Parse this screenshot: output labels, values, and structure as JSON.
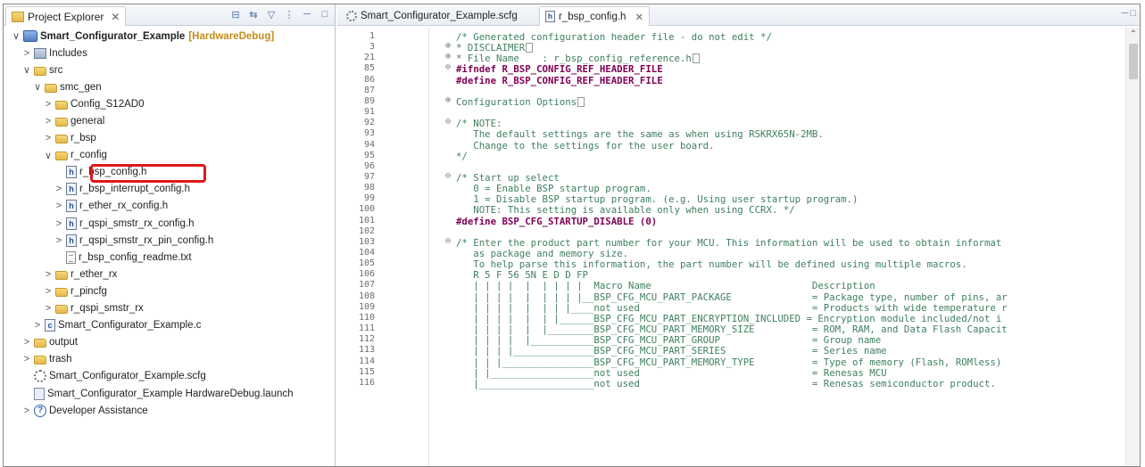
{
  "explorer": {
    "tab_label": "Project Explorer",
    "tab_close": "✕",
    "tree": [
      {
        "indent": 0,
        "chev": "∨",
        "icon": "proj",
        "label": "Smart_Configurator_Example",
        "bold": true,
        "deco": "[HardwareDebug]"
      },
      {
        "indent": 1,
        "chev": ">",
        "icon": "incl",
        "label": "Includes"
      },
      {
        "indent": 1,
        "chev": "∨",
        "icon": "folder-src",
        "label": "src"
      },
      {
        "indent": 2,
        "chev": "∨",
        "icon": "folder",
        "label": "smc_gen"
      },
      {
        "indent": 3,
        "chev": ">",
        "icon": "folder",
        "label": "Config_S12AD0"
      },
      {
        "indent": 3,
        "chev": ">",
        "icon": "folder",
        "label": "general"
      },
      {
        "indent": 3,
        "chev": ">",
        "icon": "folder",
        "label": "r_bsp"
      },
      {
        "indent": 3,
        "chev": "∨",
        "icon": "folder",
        "label": "r_config"
      },
      {
        "indent": 4,
        "chev": "",
        "icon": "hfile",
        "label": "r_bsp_config.h",
        "highlight": true
      },
      {
        "indent": 4,
        "chev": ">",
        "icon": "hfile",
        "label": "r_bsp_interrupt_config.h"
      },
      {
        "indent": 4,
        "chev": ">",
        "icon": "hfile",
        "label": "r_ether_rx_config.h"
      },
      {
        "indent": 4,
        "chev": ">",
        "icon": "hfile",
        "label": "r_qspi_smstr_rx_config.h"
      },
      {
        "indent": 4,
        "chev": ">",
        "icon": "hfile",
        "label": "r_qspi_smstr_rx_pin_config.h"
      },
      {
        "indent": 4,
        "chev": "",
        "icon": "txtfile",
        "label": "r_bsp_config_readme.txt"
      },
      {
        "indent": 3,
        "chev": ">",
        "icon": "folder",
        "label": "r_ether_rx"
      },
      {
        "indent": 3,
        "chev": ">",
        "icon": "folder",
        "label": "r_pincfg"
      },
      {
        "indent": 3,
        "chev": ">",
        "icon": "folder",
        "label": "r_qspi_smstr_rx"
      },
      {
        "indent": 2,
        "chev": ">",
        "icon": "cfile",
        "label": "Smart_Configurator_Example.c"
      },
      {
        "indent": 1,
        "chev": ">",
        "icon": "folder",
        "label": "output"
      },
      {
        "indent": 1,
        "chev": ">",
        "icon": "folder",
        "label": "trash"
      },
      {
        "indent": 1,
        "chev": "",
        "icon": "gear",
        "label": "Smart_Configurator_Example.scfg"
      },
      {
        "indent": 1,
        "chev": "",
        "icon": "launch",
        "label": "Smart_Configurator_Example HardwareDebug.launch"
      },
      {
        "indent": 1,
        "chev": ">",
        "icon": "help",
        "label": "Developer Assistance"
      }
    ]
  },
  "editor": {
    "tabs": [
      {
        "label": "Smart_Configurator_Example.scfg",
        "active": false
      },
      {
        "label": "r_bsp_config.h",
        "active": true
      }
    ],
    "tab_close": "✕",
    "lines": [
      {
        "n": "1",
        "fold": "",
        "cls": "comment",
        "text": "/* Generated configuration header file - do not edit */"
      },
      {
        "n": "3",
        "fold": "⊕",
        "cls": "comment",
        "text": "* DISCLAIMER",
        "box": true
      },
      {
        "n": "21",
        "fold": "⊕",
        "cls": "comment",
        "text": "* File Name    : r_bsp_config_reference.h",
        "box": true
      },
      {
        "n": "85",
        "fold": "⊖",
        "cls": "kw",
        "text": "#ifndef R_BSP_CONFIG_REF_HEADER_FILE"
      },
      {
        "n": "86",
        "fold": "",
        "cls": "kw",
        "text": "#define R_BSP_CONFIG_REF_HEADER_FILE"
      },
      {
        "n": "87",
        "fold": "",
        "cls": "plain",
        "text": ""
      },
      {
        "n": "89",
        "fold": "⊕",
        "cls": "comment",
        "text": "Configuration Options",
        "box": true
      },
      {
        "n": "91",
        "fold": "",
        "cls": "plain",
        "text": ""
      },
      {
        "n": "92",
        "fold": "⊖",
        "cls": "comment",
        "text": "/* NOTE:"
      },
      {
        "n": "93",
        "fold": "",
        "cls": "comment",
        "text": "   The default settings are the same as when using RSKRX65N-2MB."
      },
      {
        "n": "94",
        "fold": "",
        "cls": "comment",
        "text": "   Change to the settings for the user board."
      },
      {
        "n": "95",
        "fold": "",
        "cls": "comment",
        "text": "*/"
      },
      {
        "n": "96",
        "fold": "",
        "cls": "plain",
        "text": ""
      },
      {
        "n": "97",
        "fold": "⊖",
        "cls": "comment",
        "text": "/* Start up select"
      },
      {
        "n": "98",
        "fold": "",
        "cls": "comment",
        "text": "   0 = Enable BSP startup program."
      },
      {
        "n": "99",
        "fold": "",
        "cls": "comment",
        "text": "   1 = Disable BSP startup program. (e.g. Using user startup program.)"
      },
      {
        "n": "100",
        "fold": "",
        "cls": "comment",
        "text": "   NOTE: This setting is available only when using CCRX. */"
      },
      {
        "n": "101",
        "fold": "",
        "cls": "kw",
        "text": "#define BSP_CFG_STARTUP_DISABLE (0)"
      },
      {
        "n": "102",
        "fold": "",
        "cls": "plain",
        "text": ""
      },
      {
        "n": "103",
        "fold": "⊖",
        "cls": "comment",
        "text": "/* Enter the product part number for your MCU. This information will be used to obtain informat"
      },
      {
        "n": "104",
        "fold": "",
        "cls": "comment",
        "text": "   as package and memory size."
      },
      {
        "n": "105",
        "fold": "",
        "cls": "comment",
        "text": "   To help parse this information, the part number will be defined using multiple macros."
      },
      {
        "n": "106",
        "fold": "",
        "cls": "comment",
        "text": "   R 5 F 56 5N E D D FP"
      },
      {
        "n": "107",
        "fold": "",
        "cls": "comment",
        "text": "   | | | |  |  | | | |  Macro Name                            Description"
      },
      {
        "n": "108",
        "fold": "",
        "cls": "comment",
        "text": "   | | | |  |  | | | |__BSP_CFG_MCU_PART_PACKAGE              = Package type, number of pins, ar"
      },
      {
        "n": "109",
        "fold": "",
        "cls": "comment",
        "text": "   | | | |  |  | | |____not used                              = Products with wide temperature r"
      },
      {
        "n": "110",
        "fold": "",
        "cls": "comment",
        "text": "   | | | |  |  | |______BSP_CFG_MCU_PART_ENCRYPTION_INCLUDED = Encryption module included/not i"
      },
      {
        "n": "111",
        "fold": "",
        "cls": "comment",
        "text": "   | | | |  |  |________BSP_CFG_MCU_PART_MEMORY_SIZE          = ROM, RAM, and Data Flash Capacit"
      },
      {
        "n": "112",
        "fold": "",
        "cls": "comment",
        "text": "   | | | |  |___________BSP_CFG_MCU_PART_GROUP                = Group name"
      },
      {
        "n": "113",
        "fold": "",
        "cls": "comment",
        "text": "   | | | |______________BSP_CFG_MCU_PART_SERIES               = Series name"
      },
      {
        "n": "114",
        "fold": "",
        "cls": "comment",
        "text": "   | | |________________BSP_CFG_MCU_PART_MEMORY_TYPE          = Type of memory (Flash, ROMless)"
      },
      {
        "n": "115",
        "fold": "",
        "cls": "comment",
        "text": "   | |__________________not used                              = Renesas MCU"
      },
      {
        "n": "116",
        "fold": "",
        "cls": "comment",
        "text": "   |____________________not used                              = Renesas semiconductor product."
      }
    ]
  }
}
